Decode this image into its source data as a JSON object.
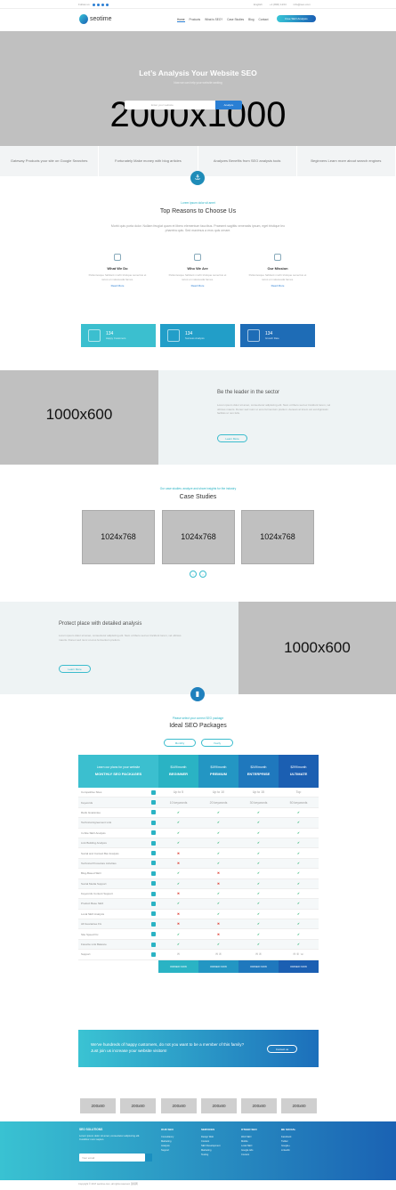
{
  "topbar": {
    "follow": "Follow us:",
    "lang": "English",
    "phone": "+1 (800) 1234",
    "email": "info@seo.com"
  },
  "nav": {
    "logo": "seotime",
    "menu": [
      "Home",
      "Products",
      "What is SEO?",
      "Case Studies",
      "Blog",
      "Contact"
    ],
    "cta": "Free SEO Analysis"
  },
  "hero": {
    "title": "Let’s Analysis Your Website SEO",
    "subtitle": "Now we can help your website ranking",
    "search_placeholder": "Enter your website",
    "search_button": "Analyze",
    "placeholder_dim": "2000x1000"
  },
  "features": [
    "Gateway Products your site on Google Searches",
    "Fortunately Make money with blog articles",
    "Analyzes Benefits from SEO analysis tools",
    "Beginners Learn more about search engines"
  ],
  "reasons": {
    "eyebrow": "Lorem ipsum dolor sit amet",
    "title": "Top Reasons to Choose Us",
    "text": "Morbi quis porta dolor. Nullam feugiat quam et libero elementum faucibus. Praesent sagittis venenatis ipsum, eget tristique leo pharetra quis. Sed maximus a eros quis ornare.",
    "cols": [
      {
        "title": "What We Do",
        "text": "Pellentesque habitant morbi tristique senectus et netus et malesuada fames.",
        "link": "Read More"
      },
      {
        "title": "Who We Are",
        "text": "Pellentesque habitant morbi tristique senectus et netus et malesuada fames.",
        "link": "Read More"
      },
      {
        "title": "Our Mission",
        "text": "Pellentesque habitant morbi tristique senectus et netus et malesuada fames.",
        "link": "Read More"
      }
    ],
    "stats": [
      {
        "num": "134",
        "label": "Happy Customers",
        "color": "#3bbfcf"
      },
      {
        "num": "134",
        "label": "Success Analysis",
        "color": "#229ec8"
      },
      {
        "num": "134",
        "label": "Growth Rate",
        "color": "#1e6cb6"
      }
    ]
  },
  "leader": {
    "placeholder_dim": "1000x600",
    "title": "Be the leader in the sector",
    "text": "Lorem ipsum dolor sit amet, consectetur adipiscing elit. Nam ut libero sed ex tincidunt lorem, vel ultrices mauris. Donec sed nunc ut eros fermentum pretium. Aenean at lorem vel est dignissim facilisis ut non felis.",
    "button": "Learn More"
  },
  "cases": {
    "eyebrow": "Our case studies: analyze and share insights for the industry",
    "title": "Case Studies",
    "items": [
      "1024x768",
      "1024x768",
      "1024x768"
    ]
  },
  "protect": {
    "title": "Protect place with detailed analysis",
    "text": "Lorem ipsum dolor sit amet, consectetur adipiscing elit. Nam ut libero sed ex tincidunt lorem, vel ultrices mauris. Donec sed nunc ut eros fermentum pretium.",
    "button": "Learn More",
    "placeholder_dim": "1000x600"
  },
  "pricing": {
    "eyebrow": "Please select your correct SEO package",
    "title": "Ideal SEO Packages",
    "toggle": [
      "Monthly",
      "Yearly"
    ],
    "header_intro": "Learn our plans for your website",
    "header_title": "MONTHLY SEO PACKAGES",
    "plans": [
      {
        "price": "$149/month",
        "name": "BEGINNER",
        "color": "#2ab3c4"
      },
      {
        "price": "$199/month",
        "name": "PREMIUM",
        "color": "#2396c3"
      },
      {
        "price": "$249/month",
        "name": "ENTERPRISE",
        "color": "#1f78bd"
      },
      {
        "price": "$299/month",
        "name": "ULTIMATE",
        "color": "#1b5fb2"
      }
    ],
    "rows": [
      {
        "f": "Competitive Sites",
        "v": [
          "Up to 5",
          "Up to 10",
          "Up to 15",
          "Top"
        ]
      },
      {
        "f": "Keywords",
        "v": [
          "10 keywords",
          "20 keywords",
          "30 keywords",
          "50 keywords"
        ]
      },
      {
        "f": "Rank Guarantee",
        "v": [
          "✔",
          "✔",
          "✔",
          "✔"
        ]
      },
      {
        "f": "Technical Agreement Link",
        "v": [
          "✔",
          "✔",
          "✔",
          "✔"
        ]
      },
      {
        "f": "In-Site SEO Analysis",
        "v": [
          "✔",
          "✔",
          "✔",
          "✔"
        ]
      },
      {
        "f": "Link Building Analysis",
        "v": [
          "✔",
          "✔",
          "✔",
          "✔"
        ]
      },
      {
        "f": "Social and Contact Bar Analysis",
        "v": [
          "✖",
          "✔",
          "✔",
          "✔"
        ]
      },
      {
        "f": "Technical Procedure Activities",
        "v": [
          "✖",
          "✔",
          "✔",
          "✔"
        ]
      },
      {
        "f": "Blog-Based SEO",
        "v": [
          "✔",
          "✖",
          "✔",
          "✔"
        ]
      },
      {
        "f": "Social Media Support",
        "v": [
          "✔",
          "✖",
          "✔",
          "✔"
        ]
      },
      {
        "f": "Keywords Content Support",
        "v": [
          "✖",
          "✔",
          "✔",
          "✔"
        ]
      },
      {
        "f": "Product Base SEO",
        "v": [
          "✔",
          "✔",
          "✔",
          "✔"
        ]
      },
      {
        "f": "Local SEO Analysis",
        "v": [
          "✖",
          "✔",
          "✔",
          "✔"
        ]
      },
      {
        "f": "All Guarantee Fix",
        "v": [
          "✖",
          "✖",
          "✔",
          "✔"
        ]
      },
      {
        "f": "Site Speed Fix",
        "v": [
          "✔",
          "✖",
          "✔",
          "✔"
        ]
      },
      {
        "f": "Favorite Link Balance",
        "v": [
          "✔",
          "✔",
          "✔",
          "✔"
        ]
      },
      {
        "f": "Support",
        "v": [
          "✉",
          "✉ ✆",
          "✉ ✆",
          "✉ ✆ ☏"
        ]
      }
    ],
    "order": "ORDER NOW"
  },
  "cta": {
    "text": "We've hundreds of happy customers, do not you want to be a member of this family? Just join us increase your website visitors!",
    "button": "Contact us"
  },
  "logos": [
    "200x80",
    "200x80",
    "200x80",
    "200x80",
    "200x80",
    "200x80"
  ],
  "footer": {
    "about_title": "SEO SOLUTIONS",
    "about_text": "Lorem ipsum dolor sit amet, consectetur adipiscing elit. Curabitur nunc sapien.",
    "subscribe_placeholder": "Your email",
    "cols": [
      {
        "title": "OUR SEO",
        "items": [
          "Consultancy",
          "Marketing",
          "Analysis",
          "Support"
        ]
      },
      {
        "title": "SERVICES",
        "items": [
          "Design Web",
          "Content",
          "SEO Development",
          "Marketing",
          "Testing"
        ]
      },
      {
        "title": "OTHER SEO",
        "items": [
          "Web SEO",
          "Mobile",
          "Local SEO",
          "Google Ads",
          "Content"
        ]
      },
      {
        "title": "BE SOCIAL",
        "items": [
          "Facebook",
          "Twitter",
          "Google+",
          "LinkedIn"
        ]
      }
    ],
    "copyright": "Copyright © 2017 seotime.com, all rights reserved. 源码网"
  }
}
